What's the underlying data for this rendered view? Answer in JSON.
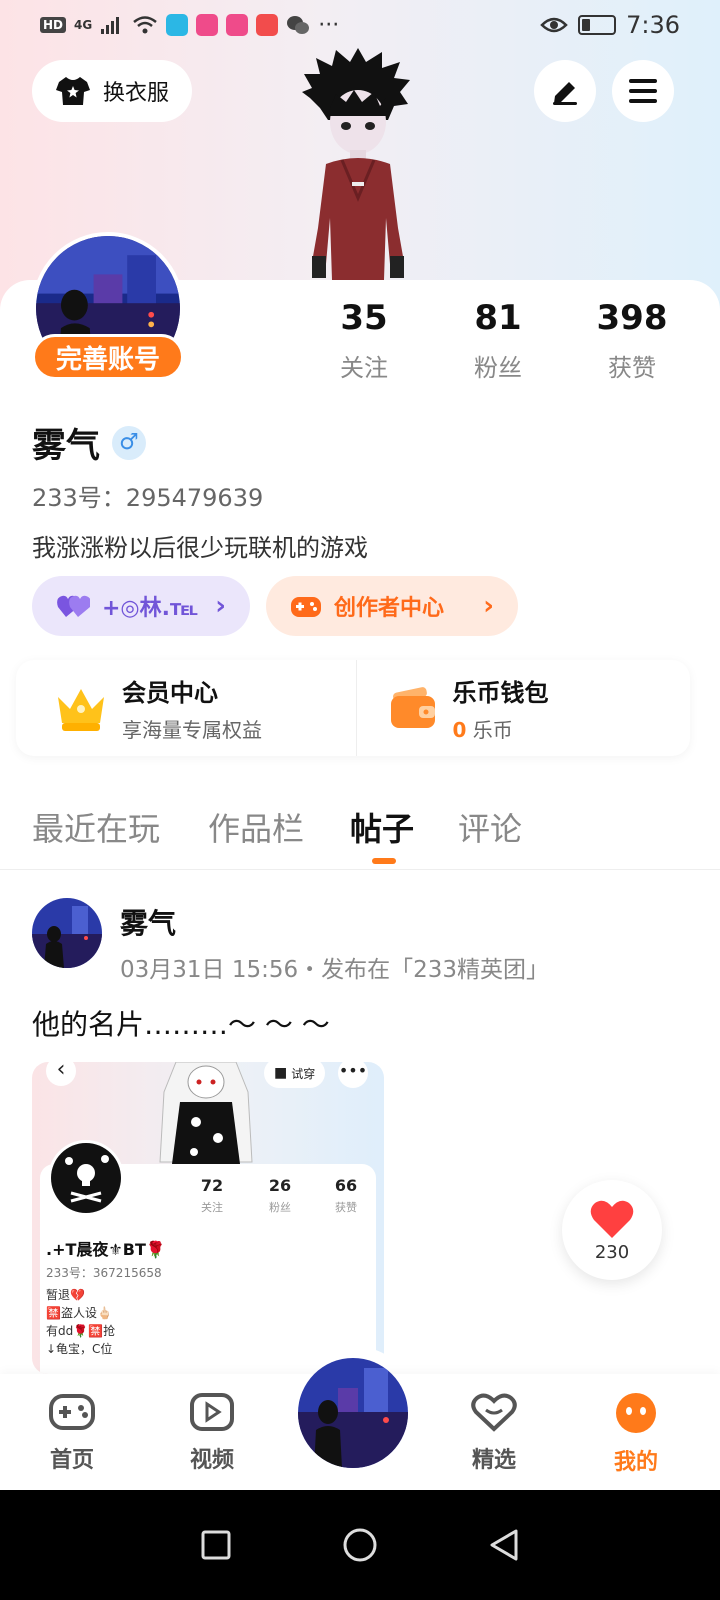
{
  "status_bar": {
    "left_badges": [
      "HD",
      "4G"
    ],
    "time": "7:36",
    "more": "···"
  },
  "header": {
    "outfit_label": "换衣服",
    "edit_icon": "edit-pen-icon",
    "menu_icon": "hamburger-menu-icon"
  },
  "profile": {
    "complete_label": "完善账号",
    "stats": [
      {
        "value": "35",
        "label": "关注"
      },
      {
        "value": "81",
        "label": "粉丝"
      },
      {
        "value": "398",
        "label": "获赞"
      }
    ],
    "nickname": "雾气",
    "gender_symbol": "♂",
    "uid": "233号：295479639",
    "bio": "我涨涨粉以后很少玩联机的游戏",
    "friend_tag": "+◎林.℡",
    "creator_center": "创作者中心"
  },
  "benefits": {
    "vip_title": "会员中心",
    "vip_sub": "享海量专属权益",
    "wallet_title": "乐币钱包",
    "wallet_amount": "0",
    "wallet_unit": "乐币"
  },
  "tabs": {
    "items": [
      "最近在玩",
      "作品栏",
      "帖子",
      "评论"
    ],
    "active": "帖子"
  },
  "post": {
    "author": "雾气",
    "meta": "03月31日 15:56・发布在「233精英团」",
    "text": "他的名片………～ ～ ～",
    "image": {
      "tryon": "试穿",
      "stats": [
        {
          "value": "72",
          "label": "关注"
        },
        {
          "value": "26",
          "label": "粉丝"
        },
        {
          "value": "66",
          "label": "获赞"
        }
      ],
      "name": ".+T晨夜⚜BT🌹",
      "uid": "233号：367215658",
      "bio_lines": [
        "暂退💔",
        "🈲盗人设🖕🏻",
        "有dd🌹🈲抢",
        "↓龟宝，C位"
      ]
    }
  },
  "like": {
    "count": "230"
  },
  "bottom_nav": {
    "items": [
      {
        "label": "首页"
      },
      {
        "label": "视频"
      },
      {
        "label": "精选"
      },
      {
        "label": "我的"
      }
    ],
    "active": "我的"
  },
  "colors": {
    "accent": "#ff7a1a",
    "purple": "#7155d8"
  }
}
